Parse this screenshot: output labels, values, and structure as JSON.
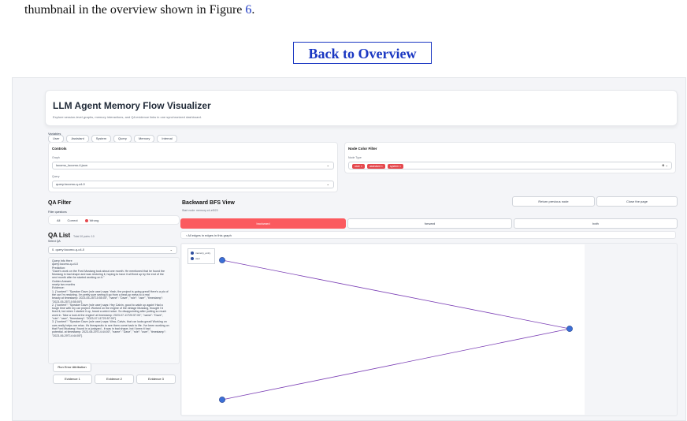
{
  "document": {
    "line_prefix": "thumbnail in the overview shown in Figure ",
    "figure_ref": "6",
    "line_suffix": ".",
    "back_button": "Back to Overview"
  },
  "app": {
    "title": "LLM Agent Memory Flow Visualizer",
    "subtitle": "Explore session-level graphs, memory interactions, and QA evidence links in one synchronized dashboard.",
    "legend_label": "Variables",
    "legend_chips": [
      "User",
      "Assistant",
      "System",
      "Query",
      "Memory",
      "Internal"
    ]
  },
  "controls": {
    "title": "Controls",
    "graph_label": "Graph",
    "graph_value": "locomo_locomo-4.json",
    "query_label": "Query",
    "query_value": "query:locomo-q-c4-0"
  },
  "node_color_filter": {
    "title": "Node Color Filter",
    "node_type_label": "Node Type",
    "tags": [
      "user",
      "assistant",
      "system"
    ]
  },
  "qa_filter": {
    "title": "QA Filter",
    "filter_label": "Filter questions",
    "options": [
      "All",
      "Correct",
      "Wrong"
    ],
    "selected": "Wrong"
  },
  "qa_list": {
    "title": "QA List",
    "subtitle": "Total 10 pairs: 10",
    "select_label": "Select QA",
    "selected_value": "0. query:locomo-q-c4-0",
    "content_lines": [
      "Query Info Here",
      "query:locomo-q-c4-0",
      "Prediction:",
      "\"Dave's work on the Ford Mustang took about one month. He mentioned that he found the",
      "Mustang in bad shape and was restoring it, hoping to have it all fixed up by the end of the",
      "next month after he started working on it.\"",
      "Golden Answer:",
      "nearly two months",
      "Evidence:",
      "1. {\"content\": \"Speaker Dave (role user) says: Yeah, the project is going great! Here's a pic of",
      "the car I'm restoring. I'm pretty sure seeing it go from a beat-up mess to a real",
      "beauty at timestamp: 2023-05-25T10:55:00\", \"name\": \"Dave\", \"role\": \"user\", \"timestamp\":",
      "\"2023-05-25T10:55:00\"}",
      "2. {\"content\": \"Speaker Dave (role user) says: Hey Calvin, good to catch up again! Had a",
      "tough time with my car project. Worked on the engine of the vintage Mustang, thought I'd",
      "fixed it, but when I started it up, heard a weird noise. So disappointing after putting so much",
      "work in. Take a look at the engine! at timestamp: 2023-07-11T20:57:00\", \"name\": \"Dave\",",
      "\"role\": \"user\", \"timestamp\": \"2023-07-11T20:57:00\"}",
      "3. {\"content\": \"Speaker Dave (role user) says: Wow, Calvin, that car looks great! Working on",
      "cars really helps me relax. It's therapeutic to see them come back to life. I've been working on",
      "that Ford Mustang I found in a junkyard - it was in bad shape, but I knew it had",
      "potential. at timestamp: 2023-06-29T14:44:00\", \"name\": \"Dave\", \"role\": \"user\", \"timestamp\":",
      "\"2023-06-29T14:44:00\"}"
    ],
    "run_button": "Run Error Attribution",
    "evidence_buttons": [
      "Evidence 1",
      "Evidence 2",
      "Evidence 3"
    ]
  },
  "bfs": {
    "title": "Backward BFS View",
    "subtitle": "Start node: memory-c4-ef023",
    "return_button": "Return previous node",
    "close_button": "Close the page",
    "directions": [
      "backward",
      "forward",
      "both"
    ],
    "active_direction": "backward",
    "edges_toggle": "All edges in edges in this graph",
    "graph_legend": [
      "memory_entry",
      "user"
    ],
    "node_color": "#3b6fd6",
    "edge_color": "#7b3fb5"
  }
}
